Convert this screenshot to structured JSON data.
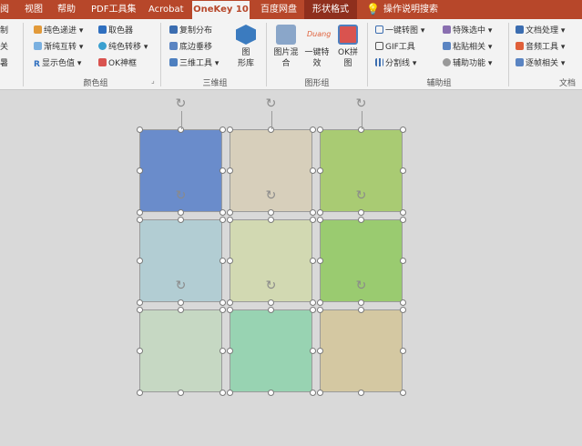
{
  "tabs": [
    {
      "label": "阅",
      "state": "normal"
    },
    {
      "label": "视图",
      "state": "normal"
    },
    {
      "label": "帮助",
      "state": "normal"
    },
    {
      "label": "PDF工具集",
      "state": "normal"
    },
    {
      "label": "Acrobat",
      "state": "normal"
    },
    {
      "label": "OneKey 10",
      "state": "active"
    },
    {
      "label": "百度网盘",
      "state": "normal"
    },
    {
      "label": "形状格式",
      "state": "highlight"
    },
    {
      "label": "操作说明搜索",
      "state": "normal"
    }
  ],
  "ribbon": {
    "left_partial": [
      "制",
      "关",
      "暑"
    ],
    "color_group": {
      "items": [
        "纯色递进",
        "取色器",
        "渐纯互转",
        "纯色转移",
        "显示色值",
        "OK神框"
      ],
      "label": "颜色组"
    },
    "three_d_group": {
      "items": [
        "复制分布",
        "底边垂移",
        "三维工具"
      ],
      "big_line1": "图",
      "big_line2": "形库",
      "label": "三维组"
    },
    "shape_group": {
      "big1_line1": "图片混",
      "big1_line2": "合",
      "big2_logo": "Duang",
      "big2_line1": "一键特",
      "big2_line2": "效",
      "big3_line1": "OK拼",
      "big3_line2": "图",
      "label": "图形组"
    },
    "aux_group": {
      "items": [
        "一键转图",
        "特殊选中",
        "GIF工具",
        "粘贴相关",
        "分割线",
        "辅助功能"
      ],
      "label": "辅助组"
    },
    "doc_group": {
      "items": [
        "文档处理",
        "音频工具",
        "逐帧相关"
      ],
      "label": "文档"
    }
  },
  "grid": {
    "colors": [
      "#6a8ccb",
      "#d7cfbb",
      "#a9cb73",
      "#b2cdd3",
      "#d2d9b2",
      "#9acb70",
      "#c6d8c3",
      "#98d3b2",
      "#d4c8a2"
    ]
  }
}
